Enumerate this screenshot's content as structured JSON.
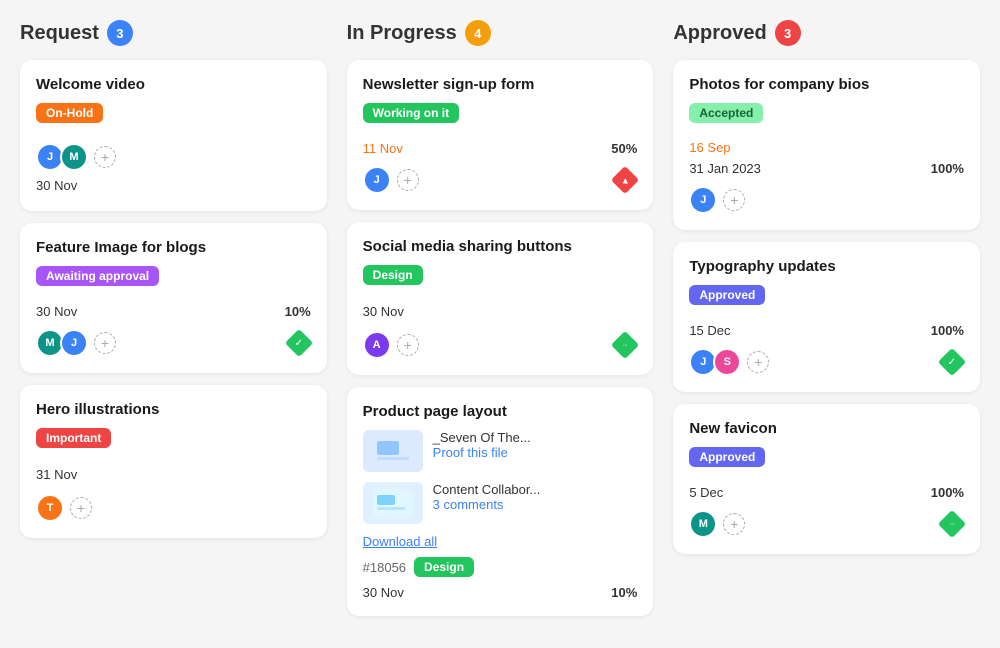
{
  "columns": [
    {
      "id": "request",
      "title": "Request",
      "badge": "3",
      "badge_color": "badge-blue",
      "cards": [
        {
          "id": "c1",
          "title": "Welcome video",
          "tag": "On-Hold",
          "tag_class": "tag-orange",
          "date": "30 Nov",
          "date_class": "card-date-black",
          "percent": "",
          "avatars": [
            "blue",
            "teal"
          ],
          "icon": "",
          "attachments": []
        },
        {
          "id": "c2",
          "title": "Feature Image for blogs",
          "tag": "Awaiting approval",
          "tag_class": "tag-purple",
          "date": "30 Nov",
          "date_class": "card-date-black",
          "percent": "10%",
          "avatars": [
            "teal",
            "blue"
          ],
          "icon": "diamond-green",
          "attachments": []
        },
        {
          "id": "c3",
          "title": "Hero illustrations",
          "tag": "Important",
          "tag_class": "tag-red",
          "date": "31 Nov",
          "date_class": "card-date-black",
          "percent": "",
          "avatars": [
            "orange"
          ],
          "icon": "",
          "attachments": []
        }
      ]
    },
    {
      "id": "in-progress",
      "title": "In Progress",
      "badge": "4",
      "badge_color": "badge-yellow",
      "cards": [
        {
          "id": "c4",
          "title": "Newsletter sign-up form",
          "tag": "Working on it",
          "tag_class": "tag-working",
          "date": "11 Nov",
          "date_class": "card-date",
          "percent": "50%",
          "avatars": [
            "blue"
          ],
          "icon": "diamond-red",
          "attachments": []
        },
        {
          "id": "c5",
          "title": "Social media sharing buttons",
          "tag": "Design",
          "tag_class": "tag-design",
          "date": "30 Nov",
          "date_class": "card-date-black",
          "percent": "",
          "avatars": [
            "purple"
          ],
          "icon": "diamond-gray",
          "attachments": []
        },
        {
          "id": "c6",
          "title": "Product page layout",
          "tag": "",
          "tag_class": "",
          "date": "30 Nov",
          "date_class": "card-date-black",
          "percent": "10%",
          "avatars": [],
          "icon": "",
          "ticket_id": "#18056",
          "ticket_tag": "Design",
          "attachments": [
            {
              "name": "_Seven Of The...",
              "action": "Proof this file",
              "thumb_color": "#dbeafe"
            },
            {
              "name": "Content Collabor...",
              "action": "3 comments",
              "thumb_color": "#e0f0ff"
            }
          ],
          "download_link": "Download all"
        }
      ]
    },
    {
      "id": "approved",
      "title": "Approved",
      "badge": "3",
      "badge_color": "badge-red",
      "cards": [
        {
          "id": "c7",
          "title": "Photos for company bios",
          "tag": "Accepted",
          "tag_class": "tag-accepted",
          "date": "16 Sep",
          "date_class": "card-date",
          "date2": "31 Jan 2023",
          "percent": "100%",
          "avatars": [
            "blue"
          ],
          "icon": ""
        },
        {
          "id": "c8",
          "title": "Typography updates",
          "tag": "Approved",
          "tag_class": "tag-approved",
          "date": "15 Dec",
          "date_class": "card-date-black",
          "percent": "100%",
          "avatars": [
            "blue",
            "pink"
          ],
          "icon": "diamond-green"
        },
        {
          "id": "c9",
          "title": "New favicon",
          "tag": "Approved",
          "tag_class": "tag-approved",
          "date": "5 Dec",
          "date_class": "card-date-black",
          "percent": "100%",
          "avatars": [
            "teal"
          ],
          "icon": "diamond-gray"
        }
      ]
    }
  ]
}
